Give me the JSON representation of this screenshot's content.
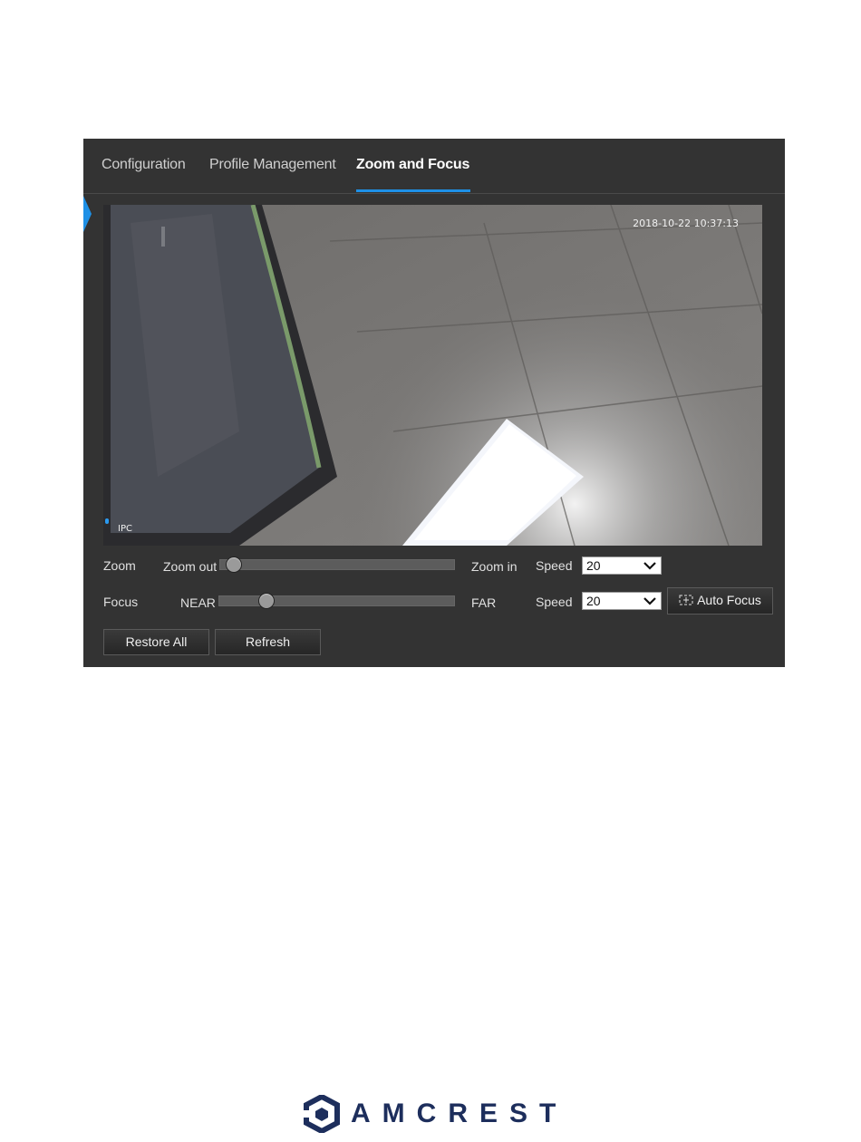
{
  "tabs": [
    {
      "label": "Configuration"
    },
    {
      "label": "Profile Management"
    },
    {
      "label": "Zoom and Focus"
    }
  ],
  "active_tab": 2,
  "video": {
    "timestamp": "2018-10-22 10:37:13",
    "channel_label": "IPC"
  },
  "zoom": {
    "label": "Zoom",
    "min_label": "Zoom out",
    "max_label": "Zoom in",
    "level": 0.03,
    "speed_label": "Speed",
    "speed_value": "20"
  },
  "focus": {
    "label": "Focus",
    "min_label": "NEAR",
    "max_label": "FAR",
    "level": 0.18,
    "speed_label": "Speed",
    "speed_value": "20"
  },
  "buttons": {
    "auto_focus": "Auto Focus",
    "restore_all": "Restore All",
    "refresh": "Refresh"
  },
  "brand": {
    "name": "AMCREST",
    "color": "#1d2e5c",
    "accent": "#1e90e6"
  }
}
